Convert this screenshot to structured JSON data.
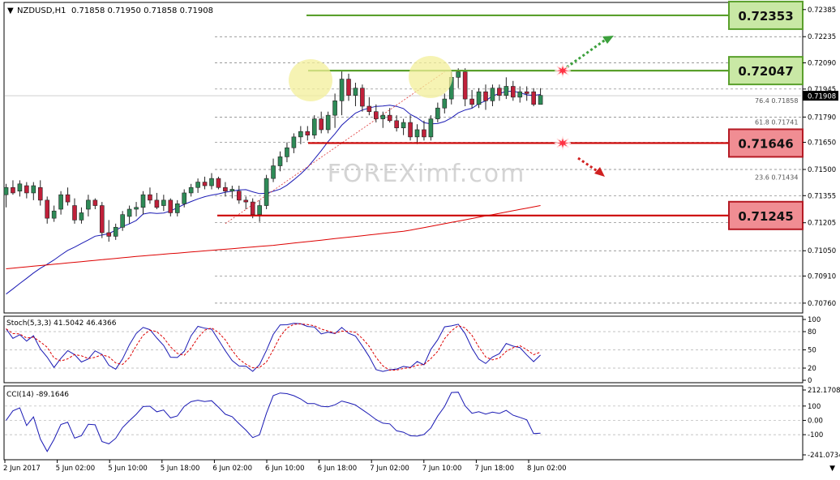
{
  "header": {
    "symbol": "NZDUSD,H1",
    "ohlc": "0.71858 0.71950 0.71858 0.71908"
  },
  "watermark": "FOREXimf.com",
  "chart_data": {
    "type": "candlestick",
    "symbol": "NZDUSD",
    "timeframe": "H1",
    "last_price": 0.71908,
    "y_range": [
      0.7071,
      0.7242
    ],
    "price_ticks": [
      "0.72385",
      "0.72235",
      "0.72090",
      "0.71945",
      "0.71790",
      "0.71650",
      "0.71500",
      "0.71355",
      "0.71205",
      "0.71050",
      "0.70910",
      "0.70760"
    ],
    "x_ticks": [
      "2 Jun 2017",
      "5 Jun 02:00",
      "5 Jun 10:00",
      "5 Jun 18:00",
      "6 Jun 02:00",
      "6 Jun 10:00",
      "6 Jun 18:00",
      "7 Jun 02:00",
      "7 Jun 10:00",
      "7 Jun 18:00",
      "8 Jun 02:00"
    ],
    "candles": [
      [
        0.7136,
        0.7142,
        0.7129,
        0.714
      ],
      [
        0.714,
        0.7144,
        0.7136,
        0.7137
      ],
      [
        0.7138,
        0.7144,
        0.7135,
        0.7142
      ],
      [
        0.7141,
        0.7143,
        0.7134,
        0.7137
      ],
      [
        0.7137,
        0.7143,
        0.7133,
        0.7141
      ],
      [
        0.714,
        0.7144,
        0.713,
        0.7133
      ],
      [
        0.7133,
        0.7135,
        0.712,
        0.7123
      ],
      [
        0.7123,
        0.713,
        0.7121,
        0.7127
      ],
      [
        0.7128,
        0.7138,
        0.7125,
        0.7136
      ],
      [
        0.7136,
        0.714,
        0.713,
        0.7132
      ],
      [
        0.713,
        0.7134,
        0.712,
        0.7122
      ],
      [
        0.7122,
        0.7129,
        0.712,
        0.7126
      ],
      [
        0.7128,
        0.7136,
        0.7124,
        0.7133
      ],
      [
        0.7133,
        0.7134,
        0.7128,
        0.713
      ],
      [
        0.713,
        0.7132,
        0.7112,
        0.7115
      ],
      [
        0.7115,
        0.7122,
        0.711,
        0.7113
      ],
      [
        0.7113,
        0.712,
        0.7111,
        0.7118
      ],
      [
        0.7118,
        0.7127,
        0.7116,
        0.7125
      ],
      [
        0.7124,
        0.713,
        0.712,
        0.7128
      ],
      [
        0.7128,
        0.7132,
        0.7124,
        0.7129
      ],
      [
        0.7129,
        0.7138,
        0.7125,
        0.7136
      ],
      [
        0.7136,
        0.714,
        0.7131,
        0.7133
      ],
      [
        0.7133,
        0.7137,
        0.7128,
        0.7129
      ],
      [
        0.713,
        0.7136,
        0.7127,
        0.7133
      ],
      [
        0.7133,
        0.7134,
        0.7124,
        0.7126
      ],
      [
        0.7126,
        0.7133,
        0.7124,
        0.7131
      ],
      [
        0.7131,
        0.7139,
        0.7129,
        0.7137
      ],
      [
        0.7137,
        0.7142,
        0.7135,
        0.714
      ],
      [
        0.714,
        0.7145,
        0.7137,
        0.7143
      ],
      [
        0.7143,
        0.7146,
        0.7139,
        0.7141
      ],
      [
        0.7141,
        0.7148,
        0.7139,
        0.7145
      ],
      [
        0.7145,
        0.7146,
        0.7139,
        0.714
      ],
      [
        0.714,
        0.7143,
        0.7135,
        0.7138
      ],
      [
        0.7138,
        0.7141,
        0.7134,
        0.7139
      ],
      [
        0.7138,
        0.7141,
        0.7131,
        0.7133
      ],
      [
        0.7133,
        0.7135,
        0.7128,
        0.7132
      ],
      [
        0.7132,
        0.7134,
        0.7123,
        0.7125
      ],
      [
        0.7125,
        0.7133,
        0.7121,
        0.713
      ],
      [
        0.713,
        0.7147,
        0.7128,
        0.7145
      ],
      [
        0.7145,
        0.7156,
        0.7143,
        0.7152
      ],
      [
        0.7152,
        0.716,
        0.7149,
        0.7157
      ],
      [
        0.7157,
        0.7165,
        0.7154,
        0.7162
      ],
      [
        0.7162,
        0.717,
        0.7159,
        0.7168
      ],
      [
        0.7168,
        0.7174,
        0.7164,
        0.7171
      ],
      [
        0.7171,
        0.7174,
        0.7166,
        0.7169
      ],
      [
        0.7169,
        0.718,
        0.7167,
        0.7178
      ],
      [
        0.7178,
        0.7182,
        0.717,
        0.7172
      ],
      [
        0.7172,
        0.7182,
        0.717,
        0.718
      ],
      [
        0.718,
        0.7192,
        0.7173,
        0.7188
      ],
      [
        0.7188,
        0.7205,
        0.718,
        0.72
      ],
      [
        0.72,
        0.7203,
        0.7188,
        0.7191
      ],
      [
        0.7191,
        0.7198,
        0.7185,
        0.7195
      ],
      [
        0.7195,
        0.7197,
        0.7182,
        0.7185
      ],
      [
        0.7185,
        0.719,
        0.718,
        0.7182
      ],
      [
        0.7182,
        0.7186,
        0.7176,
        0.7178
      ],
      [
        0.7178,
        0.7182,
        0.7173,
        0.718
      ],
      [
        0.718,
        0.7184,
        0.7176,
        0.7177
      ],
      [
        0.7177,
        0.718,
        0.7171,
        0.7173
      ],
      [
        0.7173,
        0.7178,
        0.7169,
        0.7176
      ],
      [
        0.7176,
        0.718,
        0.7166,
        0.7168
      ],
      [
        0.7168,
        0.7175,
        0.7164,
        0.7172
      ],
      [
        0.7172,
        0.7177,
        0.7166,
        0.7168
      ],
      [
        0.7168,
        0.718,
        0.7166,
        0.7178
      ],
      [
        0.7178,
        0.7187,
        0.7176,
        0.7184
      ],
      [
        0.7184,
        0.7192,
        0.7181,
        0.7189
      ],
      [
        0.7189,
        0.7204,
        0.7186,
        0.7201
      ],
      [
        0.7201,
        0.7206,
        0.7195,
        0.7204
      ],
      [
        0.7204,
        0.7206,
        0.7185,
        0.7189
      ],
      [
        0.7189,
        0.7194,
        0.7184,
        0.7186
      ],
      [
        0.7186,
        0.7195,
        0.7184,
        0.7193
      ],
      [
        0.7193,
        0.7197,
        0.7183,
        0.7188
      ],
      [
        0.7188,
        0.7197,
        0.7185,
        0.7195
      ],
      [
        0.7195,
        0.7197,
        0.7188,
        0.7191
      ],
      [
        0.7191,
        0.7201,
        0.7189,
        0.7196
      ],
      [
        0.7196,
        0.7199,
        0.7188,
        0.719
      ],
      [
        0.719,
        0.7196,
        0.7187,
        0.7193
      ],
      [
        0.7193,
        0.7196,
        0.7188,
        0.7192
      ],
      [
        0.7193,
        0.7195,
        0.7185,
        0.7186
      ],
      [
        0.7186,
        0.7195,
        0.7186,
        0.7191
      ]
    ],
    "moving_averages": [
      {
        "color": "#1a1ab4",
        "values": [
          0.7081,
          0.7097,
          0.7112,
          0.713
        ]
      },
      {
        "color": "#dd0000",
        "values": [
          0.7095,
          0.7102,
          0.7108,
          0.7116,
          0.713
        ]
      }
    ],
    "fibonacci": [
      {
        "label": "76.4",
        "price": "0.71858"
      },
      {
        "label": "61.8",
        "price": "0.71741"
      },
      {
        "label": "23.6",
        "price": "0.71434"
      }
    ],
    "levels": [
      {
        "label": "0.72353",
        "value": 0.72353,
        "kind": "resistance",
        "color": "#5aa02c"
      },
      {
        "label": "0.72047",
        "value": 0.72047,
        "kind": "resistance",
        "color": "#5aa02c"
      },
      {
        "label": "0.71646",
        "value": 0.71646,
        "kind": "support",
        "color": "#cc0000"
      },
      {
        "label": "0.71245",
        "value": 0.71245,
        "kind": "support",
        "color": "#cc0000"
      }
    ],
    "stochastic": {
      "label": "Stoch(5,3,3) 41.5042 46.4366",
      "main": 41.5042,
      "signal": 46.4366,
      "y_range": [
        0,
        100
      ],
      "ticks": [
        "100",
        "80",
        "50",
        "20",
        "0"
      ]
    },
    "cci": {
      "label": "CCI(14) -89.1646",
      "value": -89.1646,
      "y_range": [
        -241.0734,
        212.1708
      ],
      "ticks": [
        "212.1708",
        "100",
        "0.00",
        "-100",
        "-241.0734"
      ]
    }
  }
}
